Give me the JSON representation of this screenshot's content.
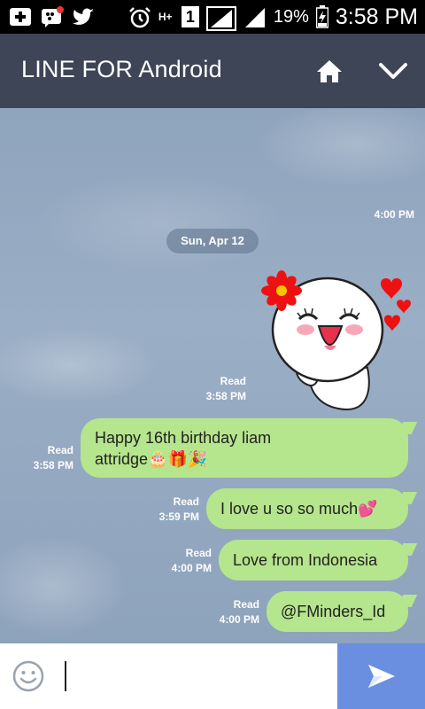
{
  "status_bar": {
    "battery_percent": "19%",
    "time": "3:58 PM",
    "sim_label": "1",
    "network_label": "H+",
    "icons_left": [
      "add-icon",
      "bbm-icon",
      "twitter-icon"
    ],
    "icons_right": [
      "alarm-icon",
      "network-icon",
      "sim-icon",
      "signal-icon",
      "signal-icon",
      "battery-icon"
    ]
  },
  "header": {
    "title": "LINE FOR Android",
    "home_icon": "home-icon",
    "collapse_icon": "chevron-down-icon"
  },
  "chat": {
    "top_time": "4:00 PM",
    "date_label": "Sun, Apr 12",
    "sticker": {
      "icon": "smiling-sticker-with-flower-and-hearts",
      "read_label": "Read",
      "time": "3:58 PM"
    },
    "messages": [
      {
        "line1": "Happy 16th birthday liam",
        "line2": "attridge🎂🎁🎉",
        "read_label": "Read",
        "time": "3:58 PM"
      },
      {
        "text": "I love u so so much💕",
        "read_label": "Read",
        "time": "3:59 PM"
      },
      {
        "text": "Love from Indonesia",
        "read_label": "Read",
        "time": "4:00 PM"
      },
      {
        "text": "@FMinders_Id",
        "read_label": "Read",
        "time": "4:00 PM"
      }
    ]
  },
  "input_bar": {
    "emoji_icon": "smiley-icon",
    "send_icon": "send-icon",
    "placeholder": ""
  },
  "colors": {
    "header_bg": "#3d4556",
    "bubble_bg": "#b5e58c",
    "send_button_bg": "#6b8fe0",
    "chat_bg": "#8fa4bd"
  }
}
